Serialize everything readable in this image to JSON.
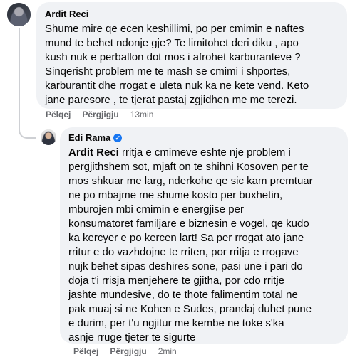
{
  "comment": {
    "author": "Ardit Reci",
    "text": "Shume mire qe ecen keshillimi, po per cmimin e naftes\nmund te behet ndonje gje? Te limitohet deri diku , apo\nkush nuk e perballon dot mos i afrohet karburanteve ?\nSinqerisht problem me te mash se cmimi i shportes,\nkarburantit dhe rrogat e uleta nuk ka ne kete vend. Keto\njane paresore , te tjerat pastaj zgjidhen me me terezi.",
    "like_label": "Pëlqej",
    "reply_label": "Përgjigju",
    "time": "13min"
  },
  "reply": {
    "author": "Edi Rama",
    "verified_icon": "check-badge-icon",
    "mention": "Ardit Reci",
    "text": " rritja e cmimeve eshte nje problem i\npergjithshem sot, mjaft on te shihni Kosoven per te\nmos shkuar me larg, nderkohe qe sic kam premtuar\nne po mbajme me shume kosto per buxhetin,\nmburojen mbi cmimin e energjise per\nkonsumatoret familjare e biznesin e vogel, qe kudo\nka kercyer e po kercen lart! Sa per rrogat ato jane\nrritur e do vazhdojne te rriten, por rritja e rrogave\nnujk behet sipas deshires sone, pasi une i pari do\ndoja t'i rrisja menjehere te gjitha, por cdo rritje\njashte mundesive, do te thote falimentim total ne\npak muaj si ne Kohen e Sudes, prandaj duhet pune\ne durim, per t'u ngjitur me kembe ne toke s'ka\nasnje rruge tjeter te sigurte",
    "like_label": "Pëlqej",
    "reply_label": "Përgjigju",
    "time": "2min"
  },
  "colors": {
    "bubble": "#f0f2f5",
    "meta": "#65676b",
    "verified": "#1877f2"
  }
}
